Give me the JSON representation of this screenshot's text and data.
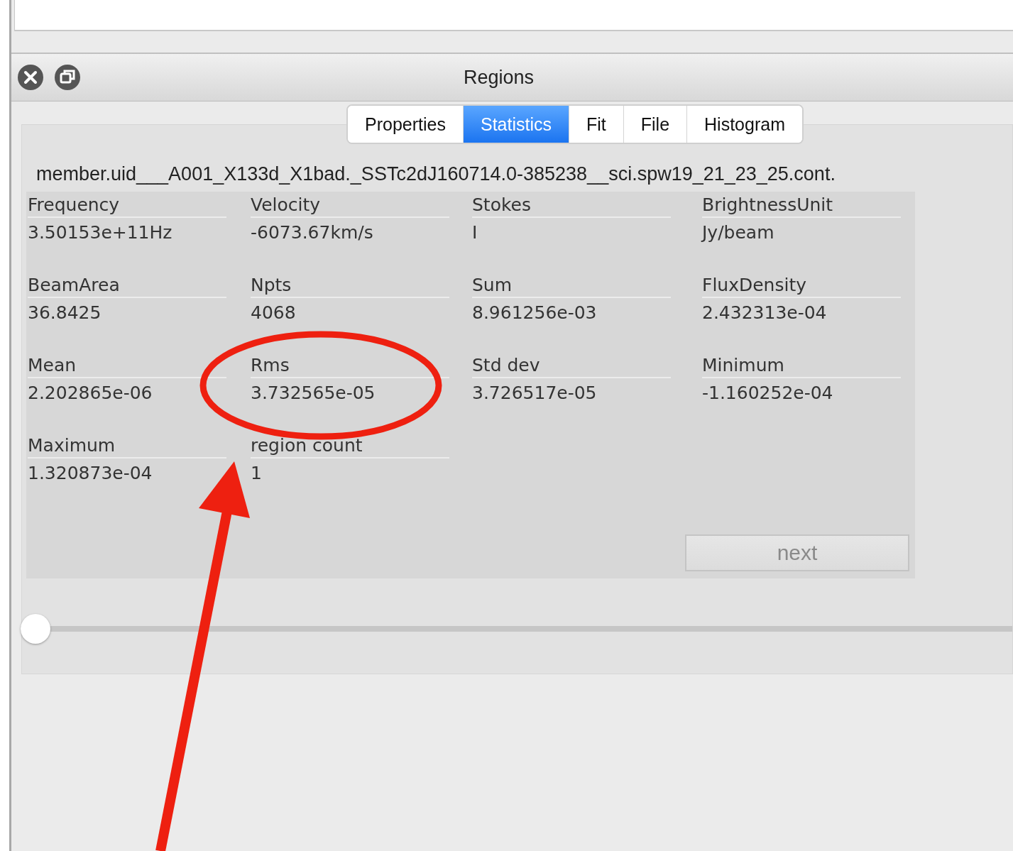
{
  "window": {
    "title": "Regions"
  },
  "tabs": [
    {
      "label": "Properties",
      "selected": false
    },
    {
      "label": "Statistics",
      "selected": true
    },
    {
      "label": "Fit",
      "selected": false
    },
    {
      "label": "File",
      "selected": false
    },
    {
      "label": "Histogram",
      "selected": false
    }
  ],
  "file_name": "member.uid___A001_X133d_X1bad._SSTc2dJ160714.0-385238__sci.spw19_21_23_25.cont.",
  "statistics": [
    {
      "label": "Frequency",
      "value": "3.50153e+11Hz"
    },
    {
      "label": "Velocity",
      "value": "-6073.67km/s"
    },
    {
      "label": "Stokes",
      "value": "I"
    },
    {
      "label": "BrightnessUnit",
      "value": "Jy/beam"
    },
    {
      "label": "BeamArea",
      "value": "36.8425"
    },
    {
      "label": "Npts",
      "value": "4068"
    },
    {
      "label": "Sum",
      "value": "8.961256e-03"
    },
    {
      "label": "FluxDensity",
      "value": "2.432313e-04"
    },
    {
      "label": "Mean",
      "value": "2.202865e-06"
    },
    {
      "label": "Rms",
      "value": "3.732565e-05"
    },
    {
      "label": "Std dev",
      "value": "3.726517e-05"
    },
    {
      "label": "Minimum",
      "value": "-1.160252e-04"
    },
    {
      "label": "Maximum",
      "value": "1.320873e-04"
    },
    {
      "label": "region count",
      "value": "1"
    }
  ],
  "next_button": {
    "label": "next",
    "disabled": true
  },
  "slider": {
    "level": 0
  }
}
